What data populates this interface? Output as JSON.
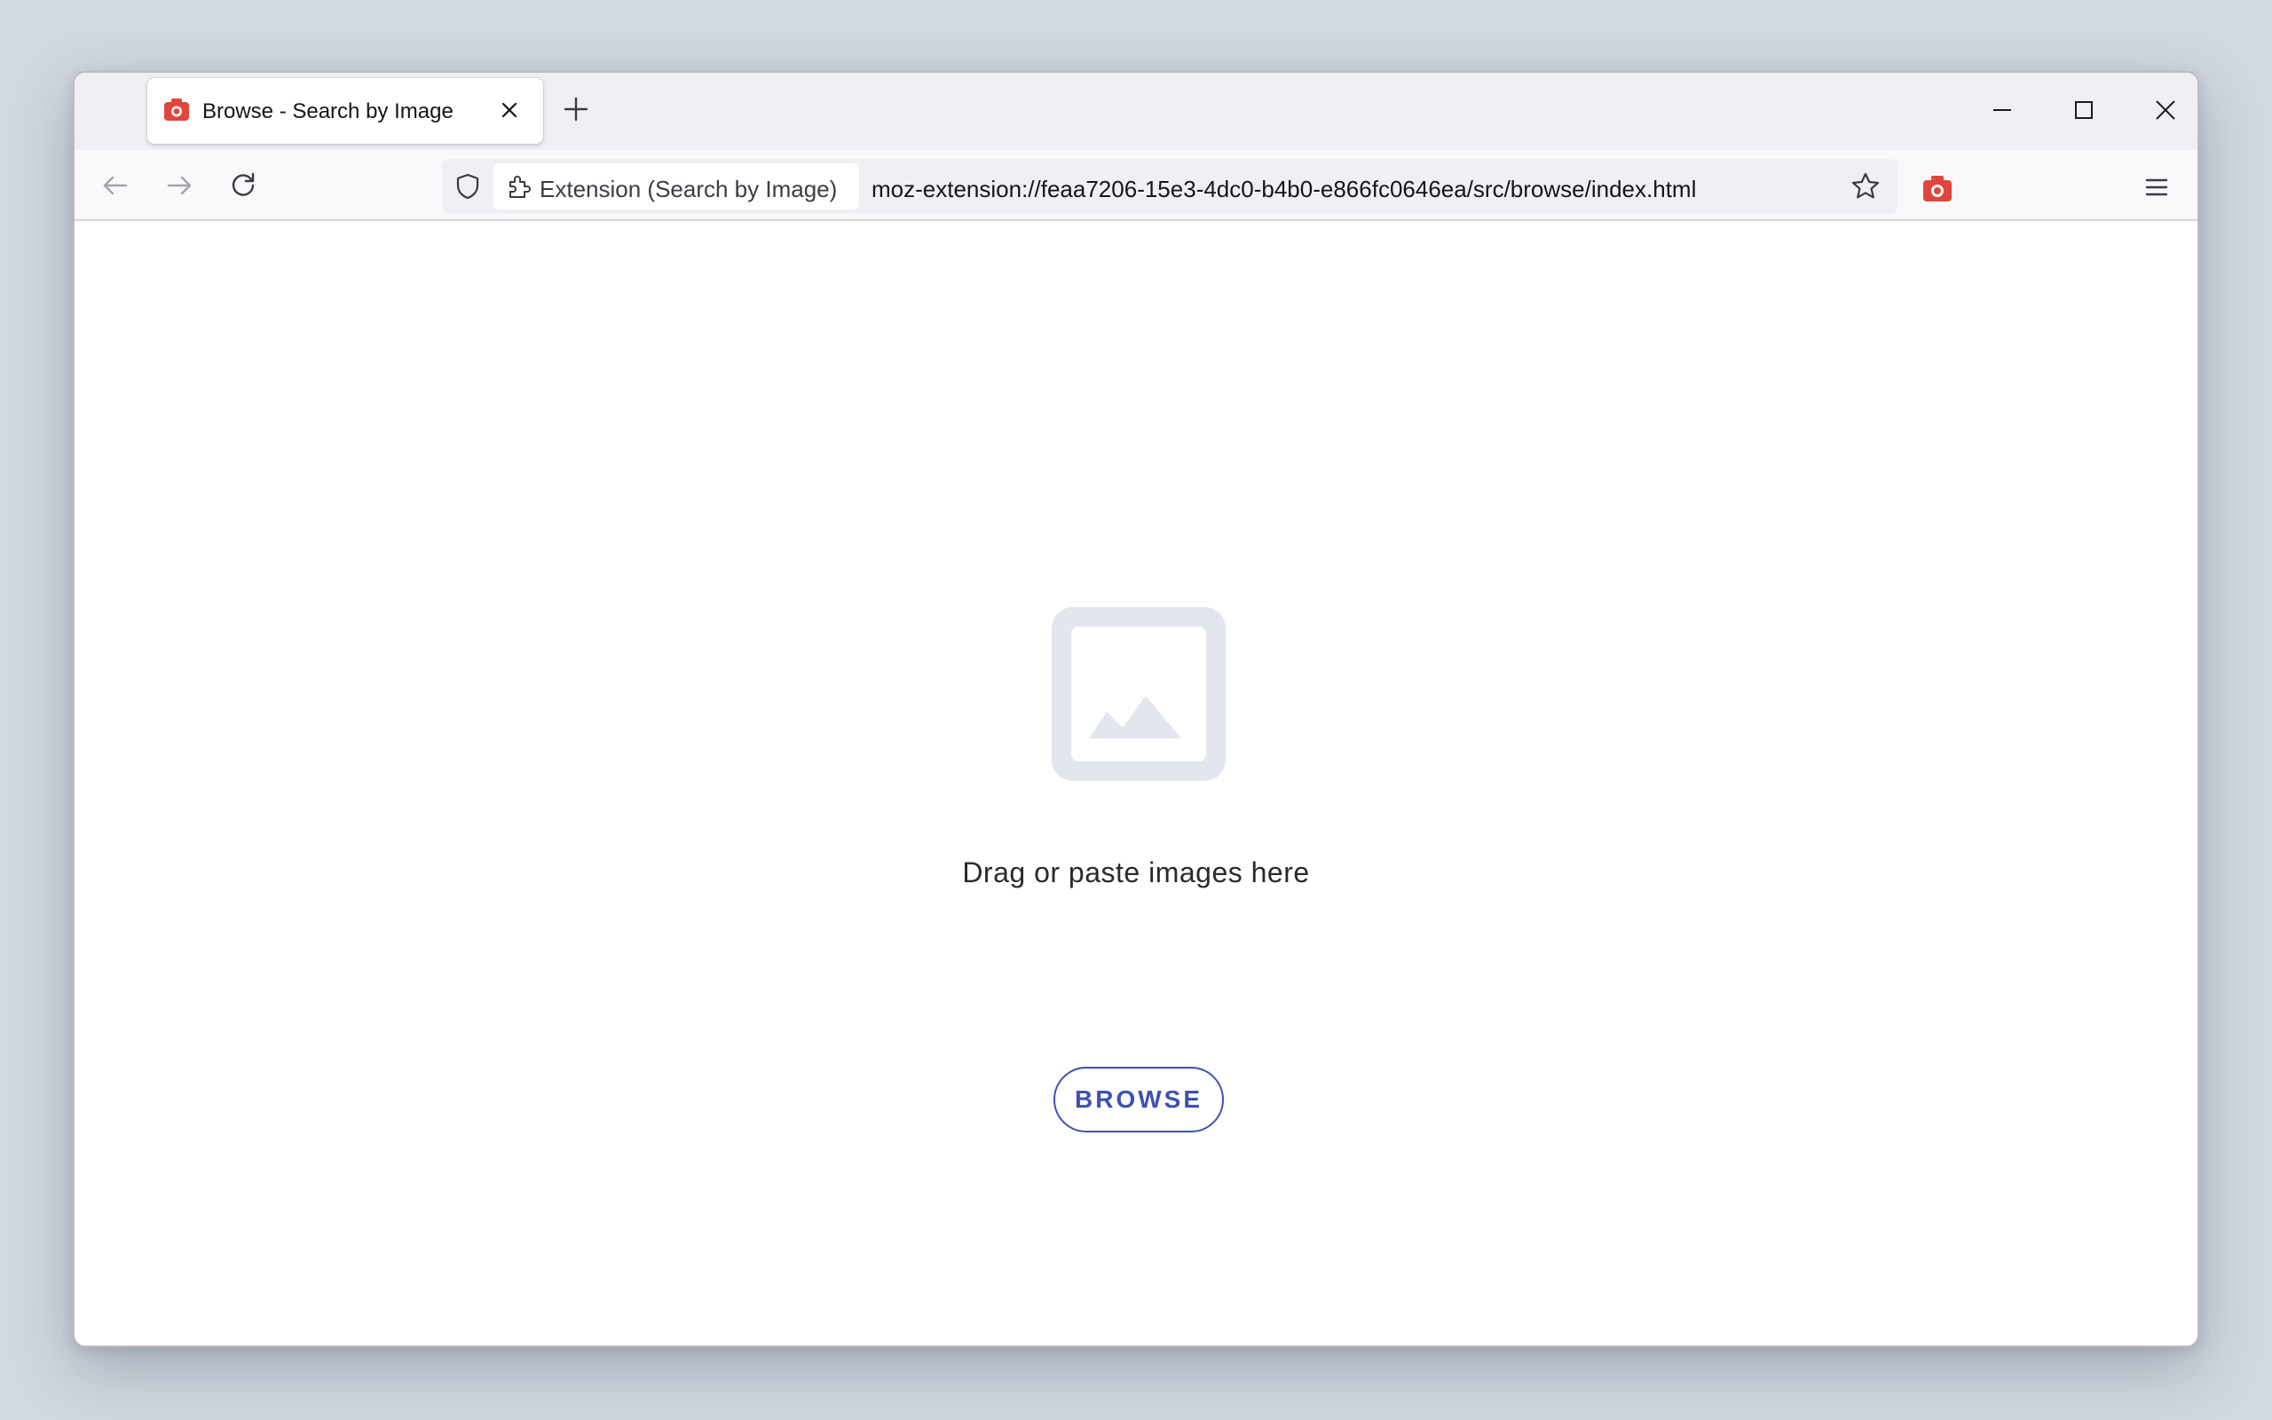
{
  "tab": {
    "title": "Browse - Search by Image",
    "favicon": "camera-icon"
  },
  "toolbar": {
    "identity_label": "Extension (Search by Image)",
    "url": "moz-extension://feaa7206-15e3-4dc0-b4b0-e866fc0646ea/src/browse/index.html"
  },
  "content": {
    "placeholder_icon": "image-placeholder-icon",
    "drop_text": "Drag or paste images here",
    "browse_label": "BROWSE"
  },
  "colors": {
    "accent": "#3f51b5",
    "extension_icon": "#e0463a",
    "placeholder": "#e3e6ec"
  }
}
